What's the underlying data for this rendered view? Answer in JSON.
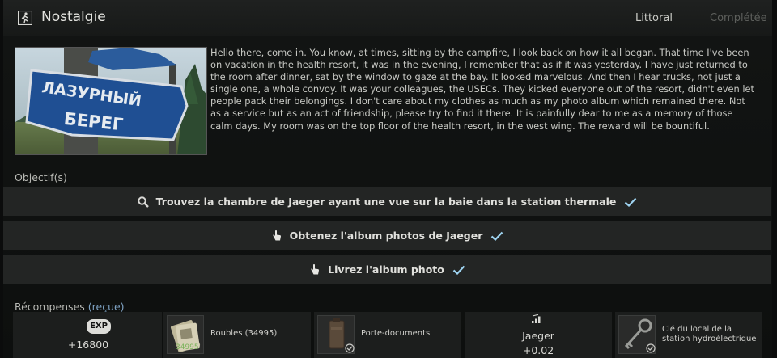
{
  "header": {
    "title": "Nostalgie",
    "location": "Littoral",
    "status": "Complétée"
  },
  "image": {
    "sign_line1": "ЛАЗУРНЫЙ",
    "sign_line2": "БЕРЕГ"
  },
  "description": "Hello there, come in. You know, at times, sitting by the campfire, I look back on how it all began. That time I've been on vacation in the health resort, it was in the evening, I remember that as if it was yesterday. I have just returned to the room after dinner, sat by the window to gaze at the bay. It looked marvelous. And then I hear trucks, not just a single one, a whole convoy. It was your colleagues, the USECs. They kicked everyone out of the resort, didn't even let people pack their belongings. I don't care about my clothes as much as my photo album which remained there. Not as a service but as an act of friendship, please try to find it there. It is painfully dear to me as a memory of those calm days. My room was on the top floor of the health resort, in the west wing. The reward will be bountiful.",
  "objectives": {
    "title": "Objectif(s)",
    "items": [
      {
        "text": "Trouvez la chambre de Jaeger ayant une vue sur la baie dans la station thermale",
        "icon": "search-icon"
      },
      {
        "text": "Obtenez l'album photos de Jaeger",
        "icon": "hand-pointer-icon"
      },
      {
        "text": "Livrez l'album photo",
        "icon": "hand-pointer-icon"
      }
    ]
  },
  "rewards": {
    "title": "Récompenses",
    "received": "(reçue)",
    "exp_badge": "EXP",
    "exp_value": "+16800",
    "roubles_label": "Roubles (34995)",
    "roubles_stack": "34995",
    "item1_label": "Porte-documents",
    "trader_name": "Jaeger",
    "trader_value": "+0.02",
    "item2_label": "Clé du local de la station hydroélectrique"
  },
  "colors": {
    "accent_check": "#9ed3f0",
    "received": "#7fa3c4"
  }
}
